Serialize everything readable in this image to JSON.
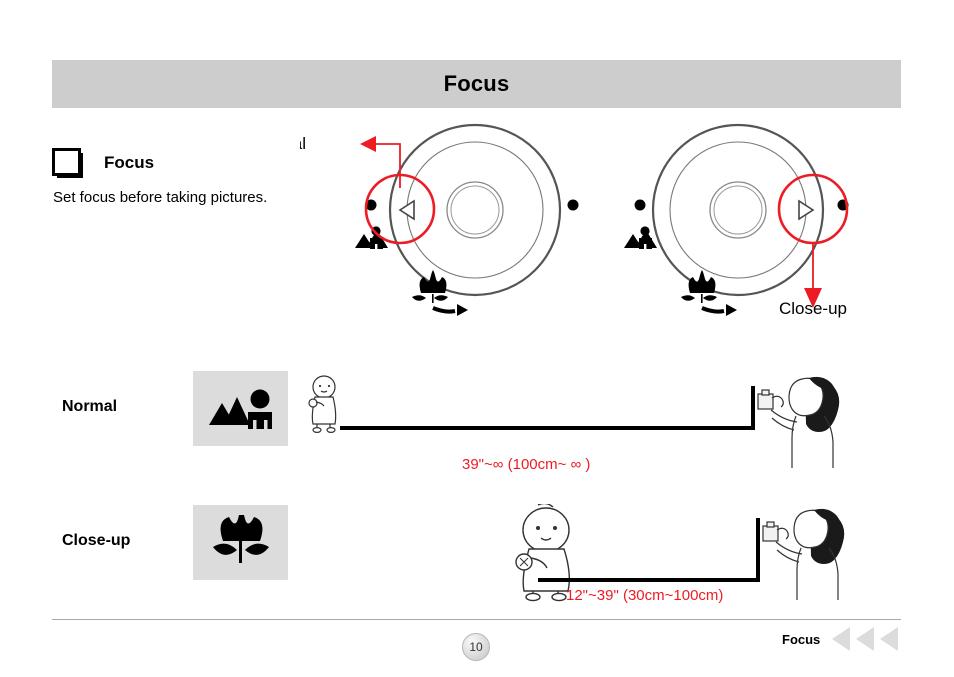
{
  "header": {
    "title": "Focus"
  },
  "section": {
    "icon": "square-stack-icon",
    "title": "Focus",
    "description": "Set focus before taking pictures."
  },
  "diagram": {
    "left_dial": {
      "callout_label": "Normal",
      "callout_icon": "arrow-left-icon",
      "selector_icon": "triangle-left-icon",
      "highlight_color": "#ed1c24",
      "markers": [
        "dot",
        "landscape-person-icon",
        "flower-icon",
        "curved-arrow-icon",
        "dot"
      ]
    },
    "right_dial": {
      "callout_label": "Close-up",
      "callout_icon": "arrow-down-icon",
      "selector_icon": "triangle-right-icon",
      "highlight_color": "#ed1c24",
      "markers": [
        "dot",
        "landscape-person-icon",
        "flower-icon",
        "curved-arrow-icon",
        "dot"
      ]
    }
  },
  "modes": [
    {
      "name": "normal",
      "label": "Normal",
      "icon": "landscape-person-icon",
      "distance": "39\"~∞ (100cm~ ∞ )",
      "subject_icon": "child-figure-icon",
      "photographer_icon": "photographer-figure-icon"
    },
    {
      "name": "closeup",
      "label": "Close-up",
      "icon": "flower-icon",
      "distance": "12\"~39\" (30cm~100cm)",
      "subject_icon": "child-figure-icon",
      "photographer_icon": "photographer-figure-icon"
    }
  ],
  "footer": {
    "page_number": "10",
    "section_name": "Focus",
    "nav_arrows": [
      "prev-arrow-1",
      "prev-arrow-2",
      "prev-arrow-3"
    ]
  },
  "colors": {
    "header_bg": "#cdcdcd",
    "icon_box_bg": "#dcdcdc",
    "accent_red": "#ed1c24",
    "nav_gray": "#dcdcdc"
  }
}
